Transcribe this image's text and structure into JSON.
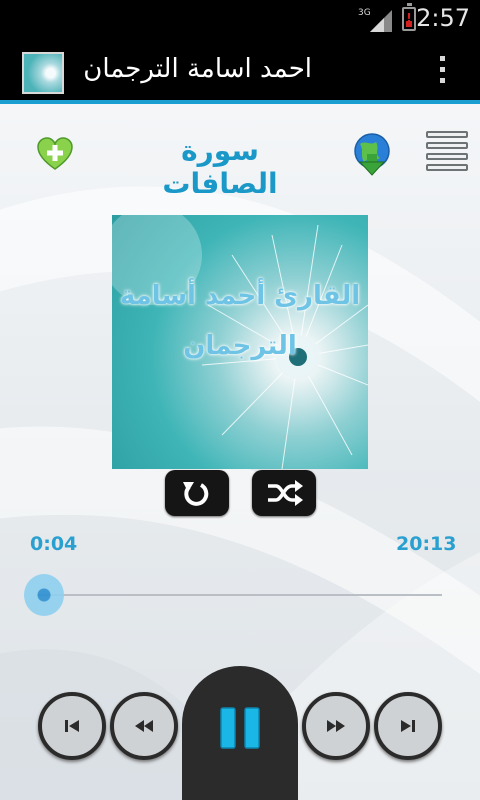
{
  "status": {
    "time": "2:57",
    "network": "3G"
  },
  "app": {
    "title": "احمد اسامة الترجمان"
  },
  "player": {
    "surah_title": "سورة الصافات",
    "cover_line1": "القارئ أحمد أسامة",
    "cover_line2": "الترجمان",
    "elapsed": "0:04",
    "total": "20:13",
    "progress": 0.003,
    "state": "playing"
  },
  "colors": {
    "accent": "#1b9fd0",
    "title": "#1a98c8",
    "time": "#2aa0d0"
  },
  "icons": {
    "favorite": "heart-plus-icon",
    "download": "globe-download-icon",
    "playlist": "list-icon",
    "repeat": "repeat-icon",
    "shuffle": "shuffle-icon",
    "prev": "skip-previous-icon",
    "rewind": "rewind-icon",
    "pause": "pause-icon",
    "forward": "fast-forward-icon",
    "next": "skip-next-icon",
    "overflow": "overflow-menu-icon"
  }
}
